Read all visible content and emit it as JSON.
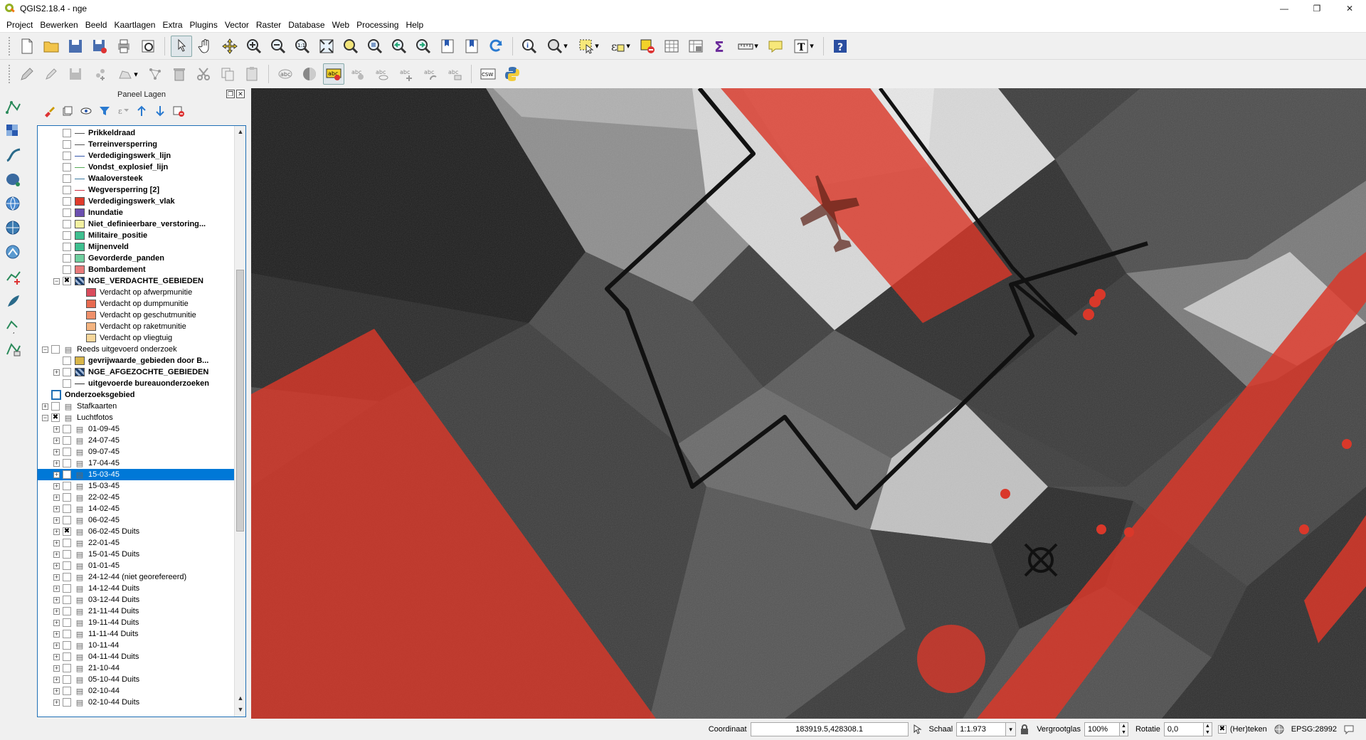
{
  "window": {
    "title": "QGIS2.18.4 - nge",
    "minimize": "—",
    "maximize": "❐",
    "close": "✕"
  },
  "menu": [
    "Project",
    "Bewerken",
    "Beeld",
    "Kaartlagen",
    "Extra",
    "Plugins",
    "Vector",
    "Raster",
    "Database",
    "Web",
    "Processing",
    "Help"
  ],
  "layers_panel": {
    "title": "Paneel Lagen"
  },
  "layers": [
    {
      "label": "Prikkeldraad",
      "bold": true,
      "indent": 1,
      "sym": "line",
      "color": "#555555",
      "checked": false
    },
    {
      "label": "Terreinversperring",
      "bold": true,
      "indent": 1,
      "sym": "line",
      "color": "#555555",
      "checked": false
    },
    {
      "label": "Verdedigingswerk_lijn",
      "bold": true,
      "indent": 1,
      "sym": "line",
      "color": "#3355aa",
      "checked": false
    },
    {
      "label": "Vondst_explosief_lijn",
      "bold": true,
      "indent": 1,
      "sym": "line",
      "color": "#55aa55",
      "checked": false
    },
    {
      "label": "Waaloversteek",
      "bold": true,
      "indent": 1,
      "sym": "line",
      "color": "#3a7aa0",
      "checked": false
    },
    {
      "label": "Wegversperring [2]",
      "bold": true,
      "indent": 1,
      "sym": "line",
      "color": "#cc3344",
      "checked": false
    },
    {
      "label": "Verdedigingswerk_vlak",
      "bold": true,
      "indent": 1,
      "sym": "fill",
      "color": "#e03c2c",
      "checked": false
    },
    {
      "label": "Inundatie",
      "bold": true,
      "indent": 1,
      "sym": "fill",
      "color": "#6b4fb0",
      "checked": false
    },
    {
      "label": "Niet_definieerbare_verstoring...",
      "bold": true,
      "indent": 1,
      "sym": "fill",
      "color": "#f2f0a0",
      "checked": false
    },
    {
      "label": "Militaire_positie",
      "bold": true,
      "indent": 1,
      "sym": "fill",
      "color": "#3fbf8f",
      "checked": false
    },
    {
      "label": "Mijnenveld",
      "bold": true,
      "indent": 1,
      "sym": "fill",
      "color": "#3fbf8f",
      "checked": false
    },
    {
      "label": "Gevorderde_panden",
      "bold": true,
      "indent": 1,
      "sym": "fill",
      "color": "#6fcf9f",
      "checked": false
    },
    {
      "label": "Bombardement",
      "bold": true,
      "indent": 1,
      "sym": "fill",
      "color": "#e87a7a",
      "checked": false
    },
    {
      "label": "NGE_VERDACHTE_GEBIEDEN",
      "bold": true,
      "indent": 1,
      "sym": "grid",
      "color": "#1a3c6a",
      "checked": true,
      "expand": "⊟"
    },
    {
      "label": "Verdacht op afwerpmunitie",
      "bold": false,
      "indent": 2,
      "sym": "fill",
      "color": "#d94c5c",
      "checked": null
    },
    {
      "label": "Verdacht op dumpmunitie",
      "bold": false,
      "indent": 2,
      "sym": "fill",
      "color": "#e86a50",
      "checked": null
    },
    {
      "label": "Verdacht op geschutmunitie",
      "bold": false,
      "indent": 2,
      "sym": "fill",
      "color": "#f0906a",
      "checked": null
    },
    {
      "label": "Verdacht op raketmunitie",
      "bold": false,
      "indent": 2,
      "sym": "fill",
      "color": "#f4b480",
      "checked": null
    },
    {
      "label": "Verdacht op vliegtuig",
      "bold": false,
      "indent": 2,
      "sym": "fill",
      "color": "#f7d79a",
      "checked": null
    },
    {
      "label": "Reeds uitgevoerd onderzoek",
      "bold": false,
      "indent": 0,
      "sym": "group",
      "color": "",
      "checked": false,
      "expand": "⊟"
    },
    {
      "label": "gevrijwaarde_gebieden door B...",
      "bold": true,
      "indent": 1,
      "sym": "fill",
      "color": "#d9b64a",
      "checked": false
    },
    {
      "label": "NGE_AFGEZOCHTE_GEBIEDEN",
      "bold": true,
      "indent": 1,
      "sym": "grid",
      "color": "#1a3c6a",
      "checked": false,
      "expand": "⊞"
    },
    {
      "label": "uitgevoerde bureauonderzoeken",
      "bold": true,
      "indent": 1,
      "sym": "line",
      "color": "#333333",
      "checked": false
    },
    {
      "label": "Onderzoeksgebied",
      "bold": true,
      "indent": 0,
      "sym": "none",
      "color": "",
      "checked": "blue"
    },
    {
      "label": "Stafkaarten",
      "bold": false,
      "indent": 0,
      "sym": "group",
      "color": "",
      "checked": false,
      "expand": "⊞"
    },
    {
      "label": "Luchtfotos",
      "bold": false,
      "indent": 0,
      "sym": "group",
      "color": "",
      "checked": "x",
      "expand": "⊟"
    },
    {
      "label": "01-09-45",
      "bold": false,
      "indent": 1,
      "sym": "group",
      "color": "",
      "checked": false,
      "expand": "⊞"
    },
    {
      "label": "24-07-45",
      "bold": false,
      "indent": 1,
      "sym": "group",
      "color": "",
      "checked": false,
      "expand": "⊞"
    },
    {
      "label": "09-07-45",
      "bold": false,
      "indent": 1,
      "sym": "group",
      "color": "",
      "checked": false,
      "expand": "⊞"
    },
    {
      "label": "17-04-45",
      "bold": false,
      "indent": 1,
      "sym": "group",
      "color": "",
      "checked": false,
      "expand": "⊞"
    },
    {
      "label": "15-03-45",
      "bold": false,
      "indent": 1,
      "sym": "group",
      "color": "",
      "checked": false,
      "expand": "⊞",
      "selected": true
    },
    {
      "label": "15-03-45",
      "bold": false,
      "indent": 1,
      "sym": "group",
      "color": "",
      "checked": false,
      "expand": "⊞"
    },
    {
      "label": "22-02-45",
      "bold": false,
      "indent": 1,
      "sym": "group",
      "color": "",
      "checked": false,
      "expand": "⊞"
    },
    {
      "label": "14-02-45",
      "bold": false,
      "indent": 1,
      "sym": "group",
      "color": "",
      "checked": false,
      "expand": "⊞"
    },
    {
      "label": "06-02-45",
      "bold": false,
      "indent": 1,
      "sym": "group",
      "color": "",
      "checked": false,
      "expand": "⊞"
    },
    {
      "label": "06-02-45 Duits",
      "bold": false,
      "indent": 1,
      "sym": "group",
      "color": "",
      "checked": "x",
      "expand": "⊞"
    },
    {
      "label": "22-01-45",
      "bold": false,
      "indent": 1,
      "sym": "group",
      "color": "",
      "checked": false,
      "expand": "⊞"
    },
    {
      "label": "15-01-45 Duits",
      "bold": false,
      "indent": 1,
      "sym": "group",
      "color": "",
      "checked": false,
      "expand": "⊞"
    },
    {
      "label": "01-01-45",
      "bold": false,
      "indent": 1,
      "sym": "group",
      "color": "",
      "checked": false,
      "expand": "⊞"
    },
    {
      "label": "24-12-44 (niet georefereerd)",
      "bold": false,
      "indent": 1,
      "sym": "group",
      "color": "",
      "checked": false,
      "expand": "⊞"
    },
    {
      "label": "14-12-44 Duits",
      "bold": false,
      "indent": 1,
      "sym": "group",
      "color": "",
      "checked": false,
      "expand": "⊞"
    },
    {
      "label": "03-12-44 Duits",
      "bold": false,
      "indent": 1,
      "sym": "group",
      "color": "",
      "checked": false,
      "expand": "⊞"
    },
    {
      "label": "21-11-44 Duits",
      "bold": false,
      "indent": 1,
      "sym": "group",
      "color": "",
      "checked": false,
      "expand": "⊞"
    },
    {
      "label": "19-11-44 Duits",
      "bold": false,
      "indent": 1,
      "sym": "group",
      "color": "",
      "checked": false,
      "expand": "⊞"
    },
    {
      "label": "11-11-44 Duits",
      "bold": false,
      "indent": 1,
      "sym": "group",
      "color": "",
      "checked": false,
      "expand": "⊞"
    },
    {
      "label": "10-11-44",
      "bold": false,
      "indent": 1,
      "sym": "group",
      "color": "",
      "checked": false,
      "expand": "⊞"
    },
    {
      "label": "04-11-44 Duits",
      "bold": false,
      "indent": 1,
      "sym": "group",
      "color": "",
      "checked": false,
      "expand": "⊞"
    },
    {
      "label": "21-10-44",
      "bold": false,
      "indent": 1,
      "sym": "group",
      "color": "",
      "checked": false,
      "expand": "⊞"
    },
    {
      "label": "05-10-44 Duits",
      "bold": false,
      "indent": 1,
      "sym": "group",
      "color": "",
      "checked": false,
      "expand": "⊞"
    },
    {
      "label": "02-10-44",
      "bold": false,
      "indent": 1,
      "sym": "group",
      "color": "",
      "checked": false,
      "expand": "⊞"
    },
    {
      "label": "02-10-44 Duits",
      "bold": false,
      "indent": 1,
      "sym": "group",
      "color": "",
      "checked": false,
      "expand": "⊞"
    }
  ],
  "status": {
    "coord_label": "Coordinaat",
    "coord_value": "183919.5,428308.1",
    "scale_label": "Schaal",
    "scale_value": "1:1.973",
    "magnifier_label": "Vergrootglas",
    "magnifier_value": "100%",
    "rotation_label": "Rotatie",
    "rotation_value": "0,0",
    "render_label": "(Her)teken",
    "crs_label": "EPSG:28992"
  },
  "colors": {
    "suspect_red": "#d9382a",
    "selection_blue": "#0078d7",
    "outline_black": "#111111"
  }
}
